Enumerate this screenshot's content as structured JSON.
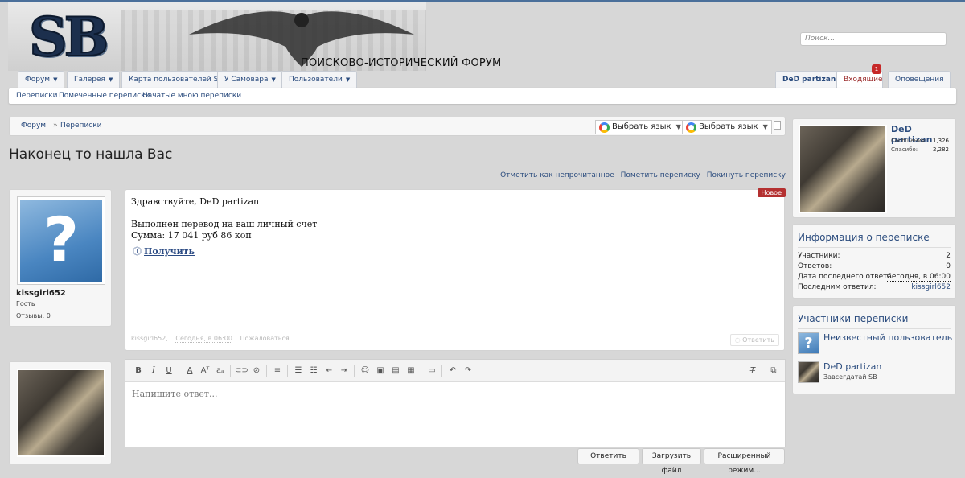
{
  "header": {
    "logo_text": "SB",
    "site_title": "ПОИСКОВО-ИСТОРИЧЕСКИЙ ФОРУМ",
    "search_placeholder": "Поиск..."
  },
  "nav": {
    "tabs": [
      {
        "label": "Форум"
      },
      {
        "label": "Галерея"
      },
      {
        "label": "Карта пользователей SB"
      },
      {
        "label": "У Самовара"
      },
      {
        "label": "Пользователи"
      }
    ],
    "user_tab": "DeD partizan",
    "inbox_tab": "Входящие",
    "inbox_badge": "1",
    "alerts_tab": "Оповещения"
  },
  "subnav": {
    "items": [
      "Переписки",
      "Помеченные переписки",
      "Начатые мною переписки"
    ]
  },
  "breadcrumb": {
    "items": [
      "Форум",
      "Переписки"
    ],
    "separator": "»"
  },
  "translate": {
    "label": "Выбрать язык"
  },
  "conversation": {
    "title": "Наконец то нашла Вас",
    "actions": [
      "Отметить как непрочитанное",
      "Пометить переписку",
      "Покинуть переписку"
    ]
  },
  "message": {
    "author": "kissgirl652",
    "role": "Гость",
    "reviews": "Отзывы: 0",
    "new_badge": "Новое",
    "body": "Здравствуйте, DeD partizan\n\nВыполнен перевод на ваш личный счет\nСумма: 17 041 руб 86 коп",
    "link": "Получить",
    "meta_author": "kissgirl652,",
    "meta_time": "Сегодня, в 06:00",
    "meta_report": "Пожаловаться",
    "reply_label": "Ответить"
  },
  "editor": {
    "placeholder": "Напишите ответ...",
    "reply_button": "Ответить",
    "upload_button": "Загрузить файл",
    "advanced_button": "Расширенный режим..."
  },
  "sidebar": {
    "profile": {
      "name": "DeD partizan",
      "messages_label": "Сообщения:",
      "messages_value": "1,326",
      "thanks_label": "Спасибо:",
      "thanks_value": "2,282"
    },
    "info": {
      "heading": "Информация о переписке",
      "rows": [
        {
          "label": "Участники:",
          "value": "2"
        },
        {
          "label": "Ответов:",
          "value": "0"
        },
        {
          "label": "Дата последнего ответа:",
          "value": "Сегодня, в 06:00"
        },
        {
          "label": "Последним ответил:",
          "value": "kissgirl652"
        }
      ]
    },
    "participants": {
      "heading": "Участники переписки",
      "items": [
        {
          "name": "Неизвестный пользователь",
          "role": ""
        },
        {
          "name": "DeD partizan",
          "role": "Завсегдатай SB"
        }
      ]
    }
  }
}
